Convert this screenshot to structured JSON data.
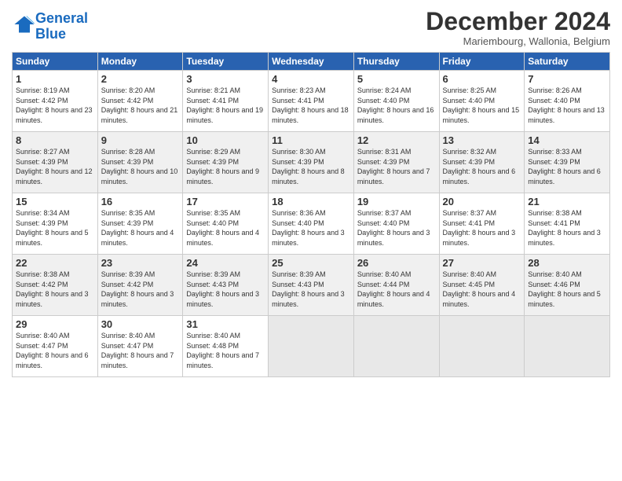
{
  "logo": {
    "line1": "General",
    "line2": "Blue"
  },
  "title": "December 2024",
  "subtitle": "Mariembourg, Wallonia, Belgium",
  "days_of_week": [
    "Sunday",
    "Monday",
    "Tuesday",
    "Wednesday",
    "Thursday",
    "Friday",
    "Saturday"
  ],
  "weeks": [
    [
      {
        "day": "1",
        "sunrise": "8:19 AM",
        "sunset": "4:42 PM",
        "daylight": "8 hours and 23 minutes."
      },
      {
        "day": "2",
        "sunrise": "8:20 AM",
        "sunset": "4:42 PM",
        "daylight": "8 hours and 21 minutes."
      },
      {
        "day": "3",
        "sunrise": "8:21 AM",
        "sunset": "4:41 PM",
        "daylight": "8 hours and 19 minutes."
      },
      {
        "day": "4",
        "sunrise": "8:23 AM",
        "sunset": "4:41 PM",
        "daylight": "8 hours and 18 minutes."
      },
      {
        "day": "5",
        "sunrise": "8:24 AM",
        "sunset": "4:40 PM",
        "daylight": "8 hours and 16 minutes."
      },
      {
        "day": "6",
        "sunrise": "8:25 AM",
        "sunset": "4:40 PM",
        "daylight": "8 hours and 15 minutes."
      },
      {
        "day": "7",
        "sunrise": "8:26 AM",
        "sunset": "4:40 PM",
        "daylight": "8 hours and 13 minutes."
      }
    ],
    [
      {
        "day": "8",
        "sunrise": "8:27 AM",
        "sunset": "4:39 PM",
        "daylight": "8 hours and 12 minutes."
      },
      {
        "day": "9",
        "sunrise": "8:28 AM",
        "sunset": "4:39 PM",
        "daylight": "8 hours and 10 minutes."
      },
      {
        "day": "10",
        "sunrise": "8:29 AM",
        "sunset": "4:39 PM",
        "daylight": "8 hours and 9 minutes."
      },
      {
        "day": "11",
        "sunrise": "8:30 AM",
        "sunset": "4:39 PM",
        "daylight": "8 hours and 8 minutes."
      },
      {
        "day": "12",
        "sunrise": "8:31 AM",
        "sunset": "4:39 PM",
        "daylight": "8 hours and 7 minutes."
      },
      {
        "day": "13",
        "sunrise": "8:32 AM",
        "sunset": "4:39 PM",
        "daylight": "8 hours and 6 minutes."
      },
      {
        "day": "14",
        "sunrise": "8:33 AM",
        "sunset": "4:39 PM",
        "daylight": "8 hours and 6 minutes."
      }
    ],
    [
      {
        "day": "15",
        "sunrise": "8:34 AM",
        "sunset": "4:39 PM",
        "daylight": "8 hours and 5 minutes."
      },
      {
        "day": "16",
        "sunrise": "8:35 AM",
        "sunset": "4:39 PM",
        "daylight": "8 hours and 4 minutes."
      },
      {
        "day": "17",
        "sunrise": "8:35 AM",
        "sunset": "4:40 PM",
        "daylight": "8 hours and 4 minutes."
      },
      {
        "day": "18",
        "sunrise": "8:36 AM",
        "sunset": "4:40 PM",
        "daylight": "8 hours and 3 minutes."
      },
      {
        "day": "19",
        "sunrise": "8:37 AM",
        "sunset": "4:40 PM",
        "daylight": "8 hours and 3 minutes."
      },
      {
        "day": "20",
        "sunrise": "8:37 AM",
        "sunset": "4:41 PM",
        "daylight": "8 hours and 3 minutes."
      },
      {
        "day": "21",
        "sunrise": "8:38 AM",
        "sunset": "4:41 PM",
        "daylight": "8 hours and 3 minutes."
      }
    ],
    [
      {
        "day": "22",
        "sunrise": "8:38 AM",
        "sunset": "4:42 PM",
        "daylight": "8 hours and 3 minutes."
      },
      {
        "day": "23",
        "sunrise": "8:39 AM",
        "sunset": "4:42 PM",
        "daylight": "8 hours and 3 minutes."
      },
      {
        "day": "24",
        "sunrise": "8:39 AM",
        "sunset": "4:43 PM",
        "daylight": "8 hours and 3 minutes."
      },
      {
        "day": "25",
        "sunrise": "8:39 AM",
        "sunset": "4:43 PM",
        "daylight": "8 hours and 3 minutes."
      },
      {
        "day": "26",
        "sunrise": "8:40 AM",
        "sunset": "4:44 PM",
        "daylight": "8 hours and 4 minutes."
      },
      {
        "day": "27",
        "sunrise": "8:40 AM",
        "sunset": "4:45 PM",
        "daylight": "8 hours and 4 minutes."
      },
      {
        "day": "28",
        "sunrise": "8:40 AM",
        "sunset": "4:46 PM",
        "daylight": "8 hours and 5 minutes."
      }
    ],
    [
      {
        "day": "29",
        "sunrise": "8:40 AM",
        "sunset": "4:47 PM",
        "daylight": "8 hours and 6 minutes."
      },
      {
        "day": "30",
        "sunrise": "8:40 AM",
        "sunset": "4:47 PM",
        "daylight": "8 hours and 7 minutes."
      },
      {
        "day": "31",
        "sunrise": "8:40 AM",
        "sunset": "4:48 PM",
        "daylight": "8 hours and 7 minutes."
      },
      null,
      null,
      null,
      null
    ]
  ]
}
